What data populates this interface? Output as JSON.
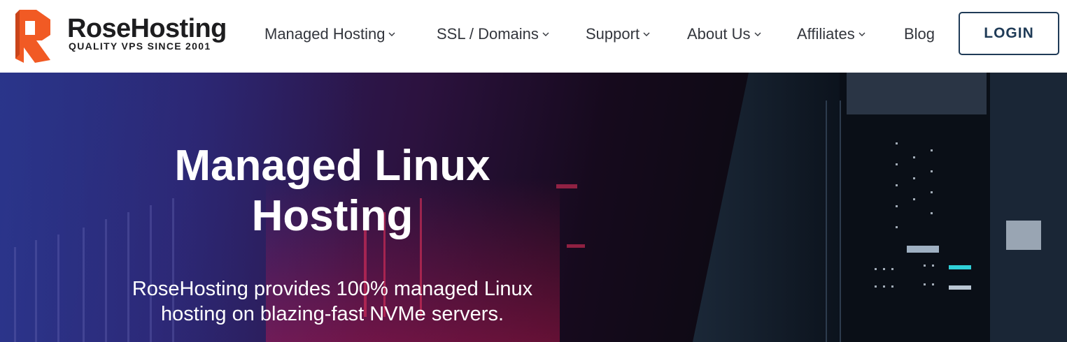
{
  "brand": {
    "name": "RoseHosting",
    "tagline": "QUALITY VPS SINCE 2001",
    "accent": "#f15a24"
  },
  "nav": {
    "items": [
      {
        "label": "Managed Hosting",
        "dropdown": true
      },
      {
        "label": "SSL / Domains",
        "dropdown": true
      },
      {
        "label": "Support",
        "dropdown": true
      },
      {
        "label": "About Us",
        "dropdown": true
      },
      {
        "label": "Affiliates",
        "dropdown": true
      },
      {
        "label": "Blog",
        "dropdown": false
      }
    ],
    "login_label": "LOGIN",
    "login_color": "#1f3b57"
  },
  "hero": {
    "title_line1": "Managed Linux",
    "title_line2": "Hosting",
    "subtitle_line1": "RoseHosting provides 100% managed Linux",
    "subtitle_line2": "hosting on blazing-fast NVMe servers."
  }
}
